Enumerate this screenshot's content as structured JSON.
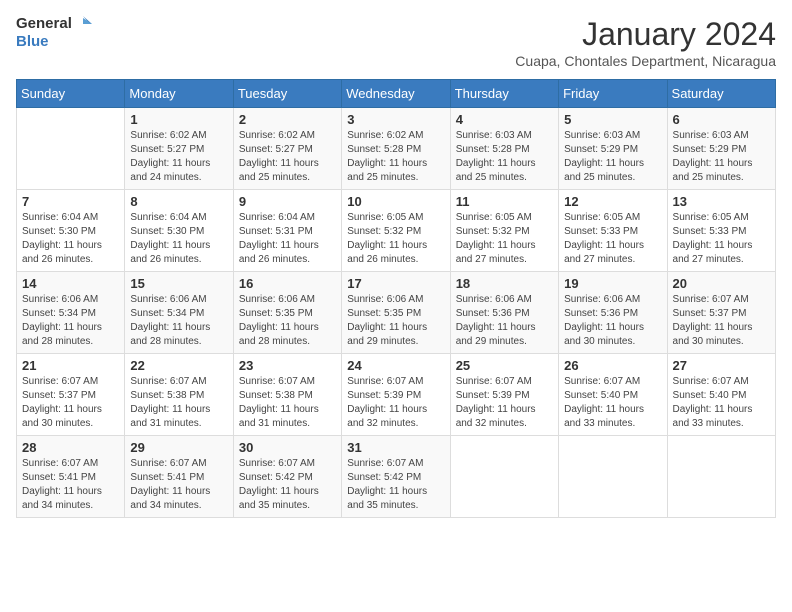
{
  "header": {
    "logo_line1": "General",
    "logo_line2": "Blue",
    "title": "January 2024",
    "subtitle": "Cuapa, Chontales Department, Nicaragua"
  },
  "days_of_week": [
    "Sunday",
    "Monday",
    "Tuesday",
    "Wednesday",
    "Thursday",
    "Friday",
    "Saturday"
  ],
  "weeks": [
    [
      {
        "day": "",
        "content": ""
      },
      {
        "day": "1",
        "content": "Sunrise: 6:02 AM\nSunset: 5:27 PM\nDaylight: 11 hours\nand 24 minutes."
      },
      {
        "day": "2",
        "content": "Sunrise: 6:02 AM\nSunset: 5:27 PM\nDaylight: 11 hours\nand 25 minutes."
      },
      {
        "day": "3",
        "content": "Sunrise: 6:02 AM\nSunset: 5:28 PM\nDaylight: 11 hours\nand 25 minutes."
      },
      {
        "day": "4",
        "content": "Sunrise: 6:03 AM\nSunset: 5:28 PM\nDaylight: 11 hours\nand 25 minutes."
      },
      {
        "day": "5",
        "content": "Sunrise: 6:03 AM\nSunset: 5:29 PM\nDaylight: 11 hours\nand 25 minutes."
      },
      {
        "day": "6",
        "content": "Sunrise: 6:03 AM\nSunset: 5:29 PM\nDaylight: 11 hours\nand 25 minutes."
      }
    ],
    [
      {
        "day": "7",
        "content": "Sunrise: 6:04 AM\nSunset: 5:30 PM\nDaylight: 11 hours\nand 26 minutes."
      },
      {
        "day": "8",
        "content": "Sunrise: 6:04 AM\nSunset: 5:30 PM\nDaylight: 11 hours\nand 26 minutes."
      },
      {
        "day": "9",
        "content": "Sunrise: 6:04 AM\nSunset: 5:31 PM\nDaylight: 11 hours\nand 26 minutes."
      },
      {
        "day": "10",
        "content": "Sunrise: 6:05 AM\nSunset: 5:32 PM\nDaylight: 11 hours\nand 26 minutes."
      },
      {
        "day": "11",
        "content": "Sunrise: 6:05 AM\nSunset: 5:32 PM\nDaylight: 11 hours\nand 27 minutes."
      },
      {
        "day": "12",
        "content": "Sunrise: 6:05 AM\nSunset: 5:33 PM\nDaylight: 11 hours\nand 27 minutes."
      },
      {
        "day": "13",
        "content": "Sunrise: 6:05 AM\nSunset: 5:33 PM\nDaylight: 11 hours\nand 27 minutes."
      }
    ],
    [
      {
        "day": "14",
        "content": "Sunrise: 6:06 AM\nSunset: 5:34 PM\nDaylight: 11 hours\nand 28 minutes."
      },
      {
        "day": "15",
        "content": "Sunrise: 6:06 AM\nSunset: 5:34 PM\nDaylight: 11 hours\nand 28 minutes."
      },
      {
        "day": "16",
        "content": "Sunrise: 6:06 AM\nSunset: 5:35 PM\nDaylight: 11 hours\nand 28 minutes."
      },
      {
        "day": "17",
        "content": "Sunrise: 6:06 AM\nSunset: 5:35 PM\nDaylight: 11 hours\nand 29 minutes."
      },
      {
        "day": "18",
        "content": "Sunrise: 6:06 AM\nSunset: 5:36 PM\nDaylight: 11 hours\nand 29 minutes."
      },
      {
        "day": "19",
        "content": "Sunrise: 6:06 AM\nSunset: 5:36 PM\nDaylight: 11 hours\nand 30 minutes."
      },
      {
        "day": "20",
        "content": "Sunrise: 6:07 AM\nSunset: 5:37 PM\nDaylight: 11 hours\nand 30 minutes."
      }
    ],
    [
      {
        "day": "21",
        "content": "Sunrise: 6:07 AM\nSunset: 5:37 PM\nDaylight: 11 hours\nand 30 minutes."
      },
      {
        "day": "22",
        "content": "Sunrise: 6:07 AM\nSunset: 5:38 PM\nDaylight: 11 hours\nand 31 minutes."
      },
      {
        "day": "23",
        "content": "Sunrise: 6:07 AM\nSunset: 5:38 PM\nDaylight: 11 hours\nand 31 minutes."
      },
      {
        "day": "24",
        "content": "Sunrise: 6:07 AM\nSunset: 5:39 PM\nDaylight: 11 hours\nand 32 minutes."
      },
      {
        "day": "25",
        "content": "Sunrise: 6:07 AM\nSunset: 5:39 PM\nDaylight: 11 hours\nand 32 minutes."
      },
      {
        "day": "26",
        "content": "Sunrise: 6:07 AM\nSunset: 5:40 PM\nDaylight: 11 hours\nand 33 minutes."
      },
      {
        "day": "27",
        "content": "Sunrise: 6:07 AM\nSunset: 5:40 PM\nDaylight: 11 hours\nand 33 minutes."
      }
    ],
    [
      {
        "day": "28",
        "content": "Sunrise: 6:07 AM\nSunset: 5:41 PM\nDaylight: 11 hours\nand 34 minutes."
      },
      {
        "day": "29",
        "content": "Sunrise: 6:07 AM\nSunset: 5:41 PM\nDaylight: 11 hours\nand 34 minutes."
      },
      {
        "day": "30",
        "content": "Sunrise: 6:07 AM\nSunset: 5:42 PM\nDaylight: 11 hours\nand 35 minutes."
      },
      {
        "day": "31",
        "content": "Sunrise: 6:07 AM\nSunset: 5:42 PM\nDaylight: 11 hours\nand 35 minutes."
      },
      {
        "day": "",
        "content": ""
      },
      {
        "day": "",
        "content": ""
      },
      {
        "day": "",
        "content": ""
      }
    ]
  ]
}
